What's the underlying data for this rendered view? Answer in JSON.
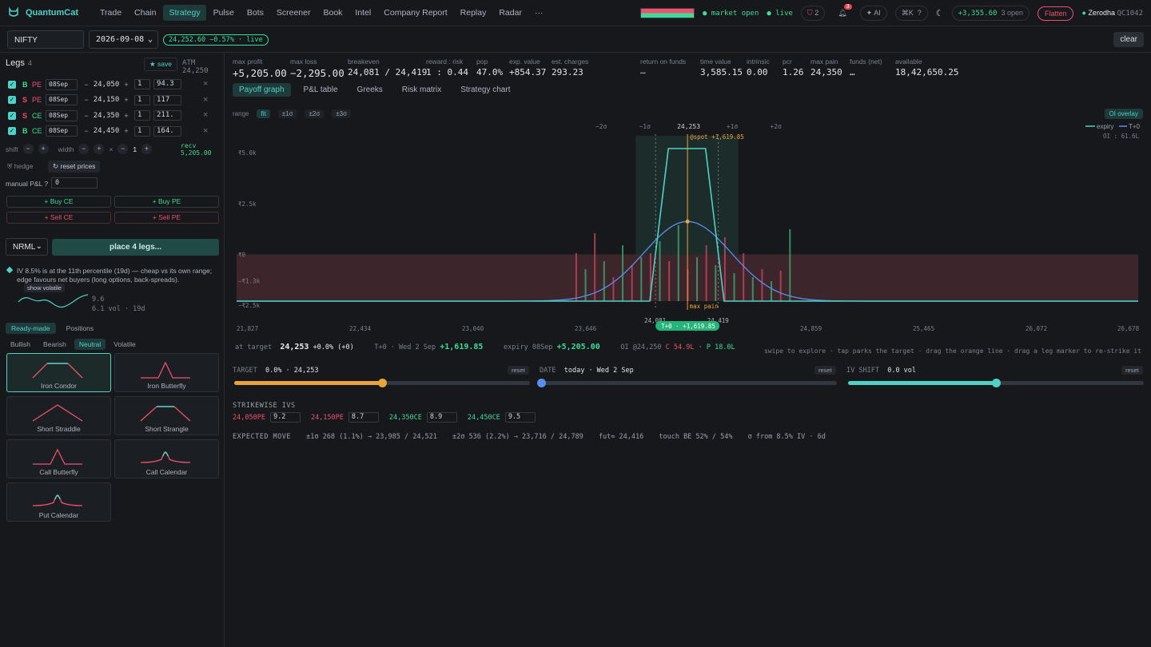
{
  "nav": {
    "brand": "QuantumCat",
    "links": [
      "Trade",
      "Chain",
      "Strategy",
      "Pulse",
      "Bots",
      "Screener",
      "Book",
      "Intel",
      "Company Report",
      "Replay",
      "Radar",
      "···"
    ],
    "active": "Strategy",
    "market": "● market open",
    "live": "● live",
    "shield_count": "2",
    "bell_count": "3",
    "ai": "✦ AI",
    "hk": "⌘K",
    "help": "?",
    "pnl": "+3,355.60",
    "open": "3 open",
    "flatten": "Flatten",
    "broker": "Zerodha",
    "account": "QC1042"
  },
  "toolbar": {
    "symbol": "NIFTY",
    "expiry": "2026-09-08",
    "live_quote": "24,252.60  −0.57% · live",
    "clear": "clear"
  },
  "legs_panel": {
    "title": "Legs",
    "count": "4",
    "save": "★ save",
    "atm": "ATM 24,250",
    "legs": [
      {
        "side": "B",
        "type": "PE",
        "expiry": "08Sep",
        "strike": "24,050",
        "qty": "1",
        "price": "94.3"
      },
      {
        "side": "S",
        "type": "PE",
        "expiry": "08Sep",
        "strike": "24,150",
        "qty": "1",
        "price": "117"
      },
      {
        "side": "S",
        "type": "CE",
        "expiry": "08Sep",
        "strike": "24,350",
        "qty": "1",
        "price": "211."
      },
      {
        "side": "B",
        "type": "CE",
        "expiry": "08Sep",
        "strike": "24,450",
        "qty": "1",
        "price": "164."
      }
    ],
    "shift_label": "shift",
    "width_label": "width",
    "mult_value": "1",
    "recv_label": "recv",
    "recv_value": "5,205.00",
    "hedge": "⛨ hedge",
    "reset_prices": "↻ reset prices",
    "manual_pnl_label": "manual P&L ?",
    "manual_pnl_value": "0",
    "buy_ce": "+ Buy CE",
    "buy_pe": "+ Buy PE",
    "sell_ce": "+ Sell CE",
    "sell_pe": "+ Sell PE",
    "product": "NRML",
    "place": "place 4 legs...",
    "iv_note": "IV 8.5% is at the 11th percentile (19d) — cheap vs its own range; edge favours net buyers (long options, back-spreads).",
    "show_volatile": "show volatile",
    "vol_hi": "9.6",
    "vol_lo": "6.1 vol · 19d"
  },
  "readymade": {
    "tabs": [
      "Ready-made",
      "Positions"
    ],
    "subtabs": [
      "Bullish",
      "Bearish",
      "Neutral",
      "Volatile"
    ],
    "active_subtab": "Neutral",
    "cards": [
      "Iron Condor",
      "Iron Butterfly",
      "Short Straddle",
      "Short Strangle",
      "Call Butterfly",
      "Call Calendar",
      "Put Calendar"
    ]
  },
  "stats": [
    {
      "k": "max profit",
      "v": "+5,205.00",
      "color": "green",
      "big": true
    },
    {
      "k": "max loss",
      "v": "−2,295.00",
      "color": "red",
      "big": true
    },
    {
      "k": "breakeven",
      "v": "24,081 / 24,419",
      "tag": "exp"
    },
    {
      "k": "reward : risk",
      "v": "1 : 0.44"
    },
    {
      "k": "pop",
      "v": "47.0%"
    },
    {
      "k": "exp. value",
      "v": "+854.37",
      "color": "green"
    },
    {
      "k": "est. charges",
      "v": "293.23",
      "tag": "r/t",
      "tag2": "net"
    },
    {
      "k": "return on funds",
      "v": "—"
    },
    {
      "k": "time value",
      "v": "3,585.15"
    },
    {
      "k": "intrinsic",
      "v": "0.00"
    },
    {
      "k": "pcr",
      "v": "1.26"
    },
    {
      "k": "max pain",
      "v": "24,350"
    },
    {
      "k": "funds (net)",
      "v": "…"
    },
    {
      "k": "available",
      "v": "18,42,650.25"
    }
  ],
  "main_tabs": [
    "Payoff graph",
    "P&L table",
    "Greeks",
    "Risk matrix",
    "Strategy chart"
  ],
  "range": {
    "label": "range",
    "options": [
      "fit",
      "±1σ",
      "±2σ",
      "±3σ"
    ],
    "active": "fit"
  },
  "oi_overlay": "OI overlay",
  "chart_data": {
    "type": "line",
    "x_ticks": [
      "21,827",
      "22,434",
      "23,040",
      "23,646",
      "24,253",
      "24,859",
      "25,465",
      "26,072",
      "26,678"
    ],
    "y_ticks": [
      "₹5.0k",
      "₹2.5k",
      "₹0",
      "−₹1.3k",
      "−₹2.5k"
    ],
    "sigma_labels": [
      "−2σ",
      "−1σ",
      "24,253",
      "+1σ",
      "+2σ"
    ],
    "legend": [
      "expiry",
      "T+0"
    ],
    "oi_label": "OI : 61.6L",
    "spot_label": "@spot +1,619.85",
    "maxpain_label": "max pain",
    "be_left": "24,081",
    "be_right": "24,419",
    "t0_badge": "T+0 · +1,619.85",
    "expiry_series": {
      "x": [
        21827,
        24050,
        24150,
        24350,
        24450,
        26678
      ],
      "y": [
        -2295,
        -2295,
        5205,
        5205,
        -2295,
        -2295
      ]
    },
    "t0_peak": 1619.85,
    "spot": 24253,
    "colors": {
      "expiry": "#4fd1c5",
      "t0": "#5b8def",
      "profit": "#1f3b36",
      "loss": "#4a2a30",
      "spot": "#e8a33c"
    }
  },
  "at_target": {
    "label": "at target",
    "value": "24,253",
    "change": "+0.0% (+0)",
    "t0": "T+0 · Wed 2 Sep",
    "t0_value": "+1,619.85",
    "expiry": "expiry 08Sep",
    "expiry_value": "+5,205.00",
    "oi": "OI @24,250",
    "oi_c": "C 54.9L",
    "oi_p": "· P 18.0L",
    "hint": "swipe to explore · tap parks the target · drag the orange line · drag a leg marker to re-strike it"
  },
  "sliders": {
    "target": {
      "label": "TARGET",
      "value": "0.0% · 24,253",
      "reset": "reset",
      "level": 0.5
    },
    "date": {
      "label": "DATE",
      "value": "today · Wed 2 Sep",
      "reset": "reset",
      "level": 0.0
    },
    "iv": {
      "label": "IV SHIFT",
      "value": "0.0 vol",
      "reset": "reset",
      "level": 0.5
    }
  },
  "strikewise": {
    "title": "STRIKEWISE IVS",
    "items": [
      {
        "k": "24,050PE",
        "v": "9.2",
        "color": "red"
      },
      {
        "k": "24,150PE",
        "v": "8.7",
        "color": "red"
      },
      {
        "k": "24,350CE",
        "v": "8.9",
        "color": "green"
      },
      {
        "k": "24,450CE",
        "v": "9.5",
        "color": "green"
      }
    ]
  },
  "expected_move": {
    "title": "EXPECTED MOVE",
    "s1": "±1σ 268 (1.1%) → 23,985 / 24,521",
    "s2": "±2σ 536 (2.2%) → 23,716 / 24,789",
    "fut": "fut≈ 24,416",
    "touch": "touch BE 52% / 54%",
    "sigma": "σ from 8.5% IV · 6d"
  }
}
